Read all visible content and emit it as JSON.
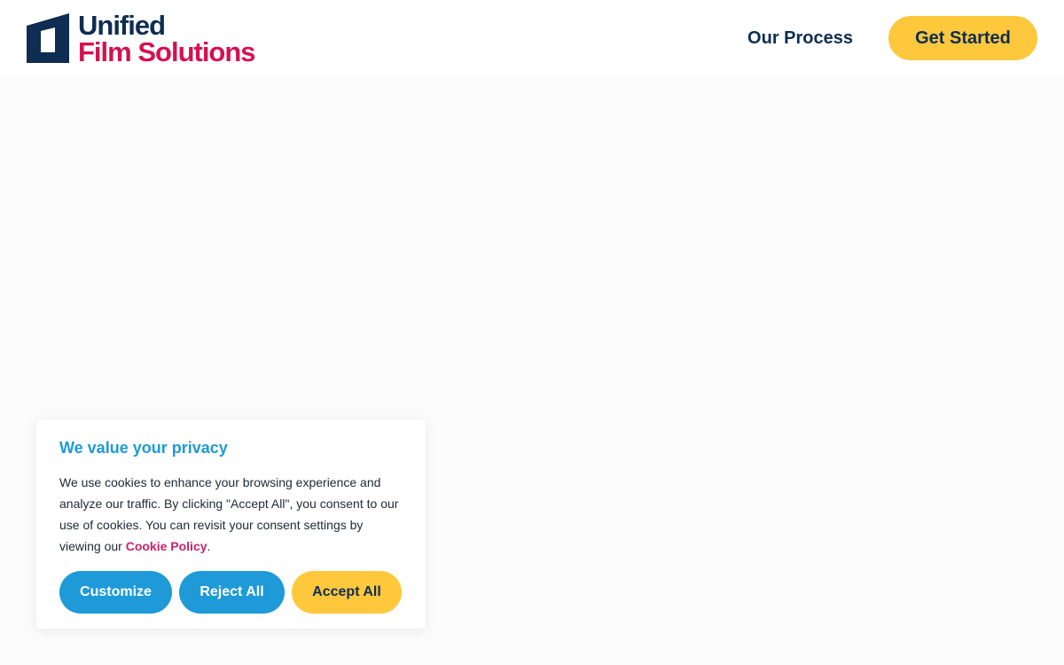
{
  "header": {
    "logo": {
      "line1": "Unified",
      "line2": "Film Solutions",
      "mark_icon": "film-frame-logo-icon"
    },
    "nav": {
      "our_process": "Our Process",
      "get_started": "Get Started"
    }
  },
  "cookie_banner": {
    "title": "We value your privacy",
    "text_before_link": "We use cookies to enhance your browsing experience and analyze our traffic. By clicking \"Accept All\", you consent to our use of cookies. You can revisit your consent settings by viewing our ",
    "link_label": "Cookie Policy",
    "text_after_link": ".",
    "buttons": {
      "customize": "Customize",
      "reject": "Reject All",
      "accept": "Accept All"
    }
  },
  "colors": {
    "navy": "#0f2d52",
    "brand_red": "#d4114e",
    "accent_yellow": "#fec83c",
    "accent_blue": "#1e9ad8",
    "link_pink": "#c9236b"
  }
}
